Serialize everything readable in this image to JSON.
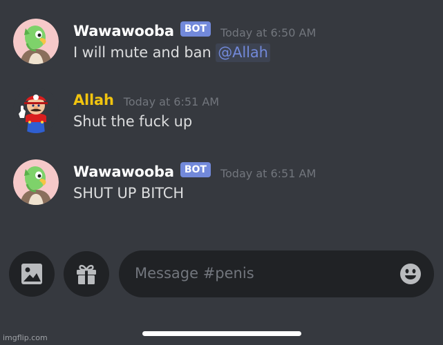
{
  "messages": [
    {
      "username": "Wawawooba",
      "badge": "BOT",
      "timestamp": "Today at 6:50 AM",
      "text": "I will mute and ban ",
      "mention": "@Allah",
      "avatar": "green-parrot-avatar",
      "name_color": "#ffffff"
    },
    {
      "username": "Allah",
      "timestamp": "Today at 6:51 AM",
      "text": "Shut the fuck up",
      "avatar": "mario-thumbs-up-avatar",
      "name_color": "#f1c40f"
    },
    {
      "username": "Wawawooba",
      "badge": "BOT",
      "timestamp": "Today at 6:51 AM",
      "text": "SHUT UP BITCH",
      "avatar": "green-parrot-avatar",
      "name_color": "#ffffff"
    }
  ],
  "composer": {
    "placeholder": "Message #penis",
    "image_button_icon": "image-icon",
    "gift_button_icon": "gift-icon",
    "emoji_button_icon": "smiley-icon"
  },
  "watermark": "imgflip.com",
  "colors": {
    "background": "#36393f",
    "input_background": "#202225",
    "bot_badge": "#7289da",
    "mention": "#7289da",
    "timestamp": "#72767d"
  }
}
